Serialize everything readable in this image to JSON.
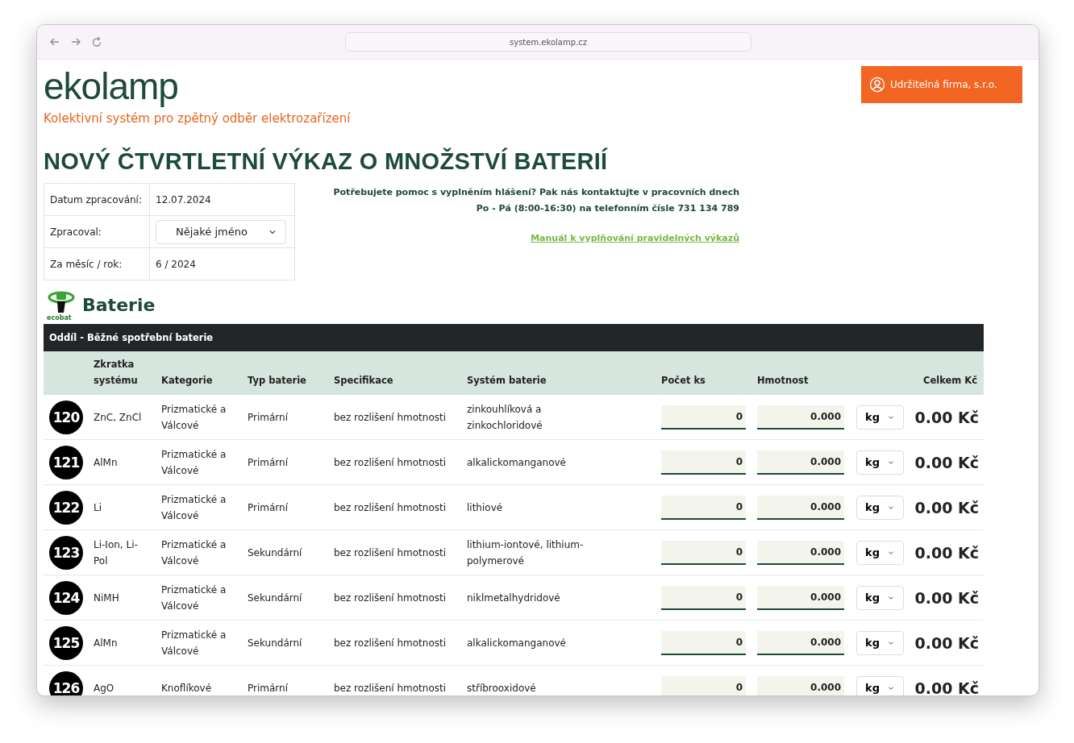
{
  "browser": {
    "url": "system.ekolamp.cz"
  },
  "header": {
    "logo": "ekolamp",
    "tagline": "Kolektivní systém pro zpětný odběr elektrozařízení",
    "account": "Udržitelná firma, s.r.o."
  },
  "title": "NOVÝ ČTVRTLETNÍ VÝKAZ O MNOŽSTVÍ BATERIÍ",
  "info": [
    {
      "kind": "text",
      "label": "Datum zpracování:",
      "value": "12.07.2024"
    },
    {
      "kind": "select",
      "label": "Zpracoval:",
      "value": "Nějaké jméno"
    },
    {
      "kind": "text",
      "label": "Za měsíc / rok:",
      "value": "6 / 2024"
    }
  ],
  "help": {
    "lines": [
      "Potřebujete pomoc s vyplněním hlášení? Pak nás kontaktujte v pracovních dnech",
      "Po - Pá (8:00-16:30) na telefonním čísle 731 134 789"
    ],
    "link": "Manuál k vyplňování pravidelných výkazů"
  },
  "section": {
    "logo_text": "ecobat",
    "title": "Baterie",
    "subsection": "Oddíl - Běžné spotřební baterie"
  },
  "table": {
    "columns": [
      "Zkratka systému",
      "Kategorie",
      "Typ baterie",
      "Specifikace",
      "Systém baterie",
      "Počet ks",
      "Hmotnost",
      "Celkem Kč"
    ],
    "rows": [
      {
        "code": "120",
        "abbr": "ZnC, ZnCl",
        "category": "Prizmatické a Válcové",
        "type": "Primární",
        "spec": "bez rozlišení hmotnosti",
        "system": "zinkouhlíková a zinkochloridové",
        "count": "0",
        "weight": "0.000",
        "unit": "kg",
        "total": "0.00 Kč"
      },
      {
        "code": "121",
        "abbr": "AlMn",
        "category": "Prizmatické a Válcové",
        "type": "Primární",
        "spec": "bez rozlišení hmotnosti",
        "system": "alkalickomanganové",
        "count": "0",
        "weight": "0.000",
        "unit": "kg",
        "total": "0.00 Kč"
      },
      {
        "code": "122",
        "abbr": "Li",
        "category": "Prizmatické a Válcové",
        "type": "Primární",
        "spec": "bez rozlišení hmotnosti",
        "system": "lithiové",
        "count": "0",
        "weight": "0.000",
        "unit": "kg",
        "total": "0.00 Kč"
      },
      {
        "code": "123",
        "abbr": "Li-Ion, Li-Pol",
        "category": "Prizmatické a Válcové",
        "type": "Sekundární",
        "spec": "bez rozlišení hmotnosti",
        "system": "lithium-iontové, lithium-polymerové",
        "count": "0",
        "weight": "0.000",
        "unit": "kg",
        "total": "0.00 Kč"
      },
      {
        "code": "124",
        "abbr": "NiMH",
        "category": "Prizmatické a Válcové",
        "type": "Sekundární",
        "spec": "bez rozlišení hmotnosti",
        "system": "niklmetalhydridové",
        "count": "0",
        "weight": "0.000",
        "unit": "kg",
        "total": "0.00 Kč"
      },
      {
        "code": "125",
        "abbr": "AlMn",
        "category": "Prizmatické a Válcové",
        "type": "Sekundární",
        "spec": "bez rozlišení hmotnosti",
        "system": "alkalickomanganové",
        "count": "0",
        "weight": "0.000",
        "unit": "kg",
        "total": "0.00 Kč"
      },
      {
        "code": "126",
        "abbr": "AgO",
        "category": "Knoflíkové",
        "type": "Primární",
        "spec": "bez rozlišení hmotnosti",
        "system": "stříbrooxidové",
        "count": "0",
        "weight": "0.000",
        "unit": "kg",
        "total": "0.00 Kč"
      }
    ]
  }
}
